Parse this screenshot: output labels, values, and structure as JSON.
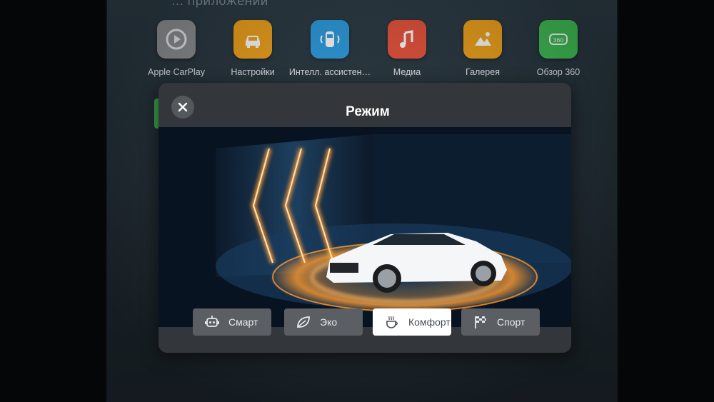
{
  "screen": {
    "section_title": "… приложений"
  },
  "apps": [
    {
      "label": "Apple CarPlay",
      "icon": "carplay-icon",
      "color": "#8c8f92"
    },
    {
      "label": "Настройки",
      "icon": "car-settings-icon",
      "color": "#f0a21a"
    },
    {
      "label": "Интелл. ассистен…",
      "icon": "assistant-car-icon",
      "color": "#2a9be0"
    },
    {
      "label": "Медиа",
      "icon": "music-note-icon",
      "color": "#e8503a"
    },
    {
      "label": "Галерея",
      "icon": "gallery-icon",
      "color": "#f0a21a"
    },
    {
      "label": "Обзор 360",
      "icon": "camera-360-icon",
      "color": "#3fbf55"
    }
  ],
  "dialog": {
    "title": "Режим",
    "close_icon": "close-icon"
  },
  "modes": [
    {
      "label": "Смарт",
      "icon": "robot-icon",
      "active": false
    },
    {
      "label": "Эко",
      "icon": "leaf-icon",
      "active": false
    },
    {
      "label": "Комфорт",
      "icon": "coffee-cup-icon",
      "active": true
    },
    {
      "label": "Спорт",
      "icon": "checkered-flag-icon",
      "active": false
    }
  ],
  "colors": {
    "accent_glow": "#ff9a2e",
    "dialog_bg": "#33373b",
    "active_mode_bg": "#ffffff"
  }
}
